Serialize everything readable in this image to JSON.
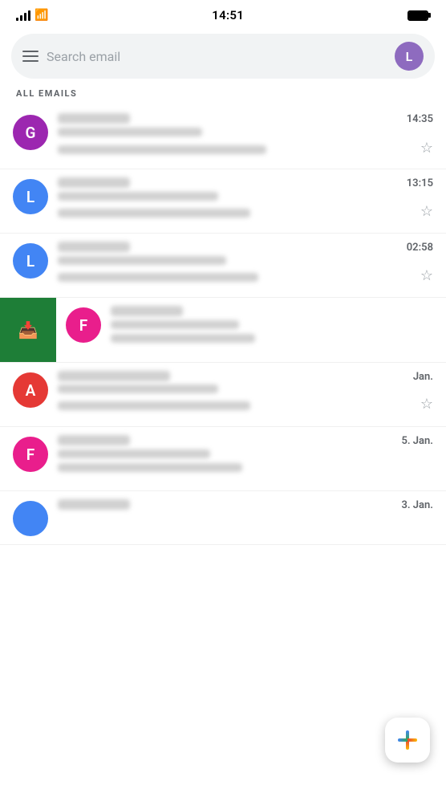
{
  "statusBar": {
    "time": "14:51"
  },
  "searchBar": {
    "placeholder": "Search email",
    "avatar": {
      "letter": "L",
      "color": "#8e6bbf"
    }
  },
  "sectionLabel": "ALL EMAILS",
  "emails": [
    {
      "id": "email-1",
      "avatar": {
        "letter": "G",
        "color": "#9c27b0"
      },
      "time": "14:35",
      "starred": false
    },
    {
      "id": "email-2",
      "avatar": {
        "letter": "L",
        "color": "#4285f4"
      },
      "time": "13:15",
      "starred": false
    },
    {
      "id": "email-3",
      "avatar": {
        "letter": "L",
        "color": "#4285f4"
      },
      "time": "02:58",
      "starred": false
    },
    {
      "id": "email-4-swipe",
      "avatar": {
        "letter": "F",
        "color": "#e91e8c"
      },
      "time": "",
      "starred": false,
      "swipe": true
    },
    {
      "id": "email-5",
      "avatar": {
        "letter": "A",
        "color": "#e53935"
      },
      "time": "Jan.",
      "starred": false
    },
    {
      "id": "email-6",
      "avatar": {
        "letter": "F",
        "color": "#e91e8c"
      },
      "time": "5. Jan.",
      "starred": false
    },
    {
      "id": "email-7",
      "avatar": {
        "letter": "?",
        "color": "#4285f4"
      },
      "time": "3. Jan.",
      "starred": false
    }
  ],
  "fab": {
    "label": "Compose"
  }
}
